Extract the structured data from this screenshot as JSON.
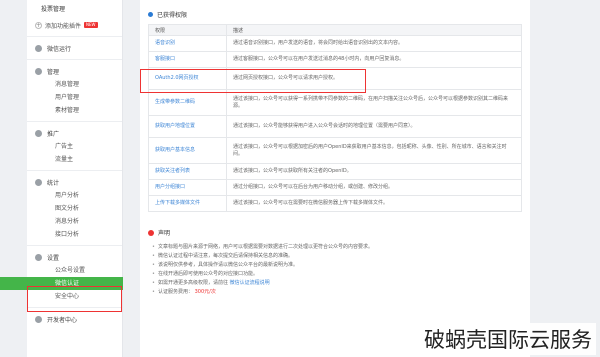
{
  "sidebar": {
    "top_item": "投票管理",
    "top_badge": "NEW",
    "add_feature": "添加功能插件",
    "add_badge": "NEW",
    "sections": [
      {
        "label": "微信运行",
        "items": []
      },
      {
        "label": "管理",
        "items": [
          "消息管理",
          "用户管理",
          "素材管理"
        ]
      },
      {
        "label": "推广",
        "items": [
          "广告主",
          "流量主"
        ]
      },
      {
        "label": "统计",
        "items": [
          "用户分析",
          "图文分析",
          "消息分析",
          "接口分析"
        ]
      },
      {
        "label": "设置",
        "items": [
          "公众号设置",
          "微信认证",
          "安全中心"
        ]
      },
      {
        "label": "开发者中心",
        "items": []
      }
    ]
  },
  "main": {
    "section_title": "已获得权限",
    "table_headers": [
      "权限",
      "描述"
    ],
    "rows": [
      {
        "name": "语音识别",
        "desc": "通过语音识别接口，用户发送的语音，将会同时给出语音识别出的文本内容。"
      },
      {
        "name": "客服接口",
        "desc": "通过客服接口，公众号可以在用户发送过消息的48小时内，向用户回复消息。"
      },
      {
        "name": "OAuth2.0网页授权",
        "desc": "通过网页授权接口，公众号可以请求用户授权。"
      },
      {
        "name": "生成带参数二维码",
        "desc": "通过该接口，公众号可以获得一系列携带不同参数的二维码，在用户扫描关注公众号后，公众号可以根据参数识别其二维码来源。"
      },
      {
        "name": "获取用户地理位置",
        "desc": "通过该接口，公众号能够获得用户进入公众号会话时的地理位置（需要用户同意）。"
      },
      {
        "name": "获取用户基本信息",
        "desc": "通过该接口，公众号可以根据加密后的用户OpenID来获取用户基本信息，包括昵称、头像、性别、所在城市、语言和关注时间。"
      },
      {
        "name": "获取关注者列表",
        "desc": "通过该接口，公众号可以获取所有关注者的OpenID。"
      },
      {
        "name": "用户分组接口",
        "desc": "通过分组接口，公众号可以在后台为用户移动分组，或创建、修改分组。"
      },
      {
        "name": "上传下载多媒体文件",
        "desc": "通过该接口，公众号可以在需要时在微信服务器上传下载多媒体文件。"
      }
    ]
  },
  "notes": {
    "title": "声明",
    "items": [
      "文章标题与图片来源于网络，用户可以根据需要对数据进行二次处理以更符合公众号的内容要求。",
      "微信认证过程中请注意，每次提交后请保持相关信息的准确。",
      "该说明仅供参考，具体操作请以微信公众平台的最新说明为准。",
      "在线开通后即可使用公众号的对应接口功能。"
    ],
    "link_line_prefix": "如需开通更多高级权限，请前往",
    "link_text": "微信认证流程说明",
    "expire_prefix": "认证服务费用：",
    "expire_value": "300元/次"
  },
  "watermark": "破蜗壳国际云服务",
  "colors": {
    "accent": "#44b549",
    "link": "#3e86d6",
    "highlight": "#e33333"
  }
}
